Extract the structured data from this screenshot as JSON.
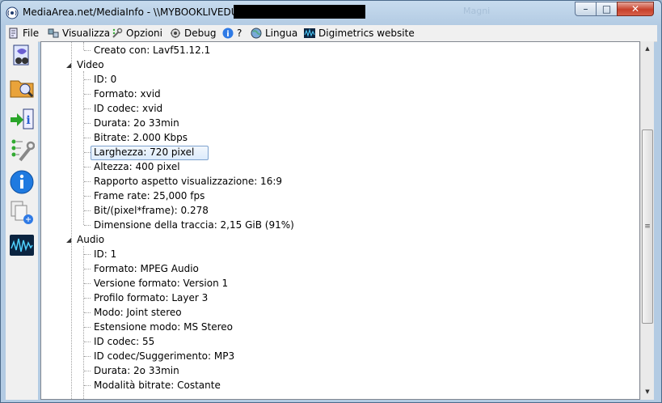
{
  "window": {
    "title": "MediaArea.net/MediaInfo - \\\\MYBOOKLIVEDUO\\",
    "ghost_text": "Magni",
    "controls": {
      "minimize": "–",
      "maximize": "□",
      "close": "✕"
    }
  },
  "menu": [
    {
      "label": "File",
      "icon": "file-icon"
    },
    {
      "label": "Visualizza",
      "icon": "view-icon"
    },
    {
      "label": "Opzioni",
      "icon": "options-icon"
    },
    {
      "label": "Debug",
      "icon": "debug-icon"
    },
    {
      "label": "?",
      "icon": "help-icon"
    },
    {
      "label": "Lingua",
      "icon": "language-icon"
    },
    {
      "label": "Digimetrics website",
      "icon": "digimetrics-icon"
    }
  ],
  "sidebar": [
    "open-file-icon",
    "open-folder-icon",
    "export-icon",
    "preferences-icon",
    "info-icon",
    "compare-icon",
    "digimetrics-icon"
  ],
  "tree": {
    "top_item": "Creato con: Lavf51.12.1",
    "video": {
      "label": "Video",
      "items": [
        "ID: 0",
        "Formato: xvid",
        "ID codec: xvid",
        "Durata: 2o 33min",
        "Bitrate: 2.000 Kbps",
        "Larghezza: 720 pixel",
        "Altezza: 400 pixel",
        "Rapporto aspetto visualizzazione: 16:9",
        "Frame rate: 25,000 fps",
        "Bit/(pixel*frame): 0.278",
        "Dimensione della traccia: 2,15 GiB (91%)"
      ]
    },
    "audio": {
      "label": "Audio",
      "items": [
        "ID: 1",
        "Formato: MPEG Audio",
        "Versione formato: Version 1",
        "Profilo formato: Layer 3",
        "Modo: Joint stereo",
        "Estensione modo: MS Stereo",
        "ID codec: 55",
        "ID codec/Suggerimento: MP3",
        "Durata: 2o 33min",
        "Modalità bitrate: Costante"
      ]
    },
    "selected_item": "Larghezza: 720 pixel"
  },
  "colors": {
    "selection_border": "#7da2ce",
    "titlebar": "#b3cbe3",
    "close_button": "#c7412b"
  }
}
